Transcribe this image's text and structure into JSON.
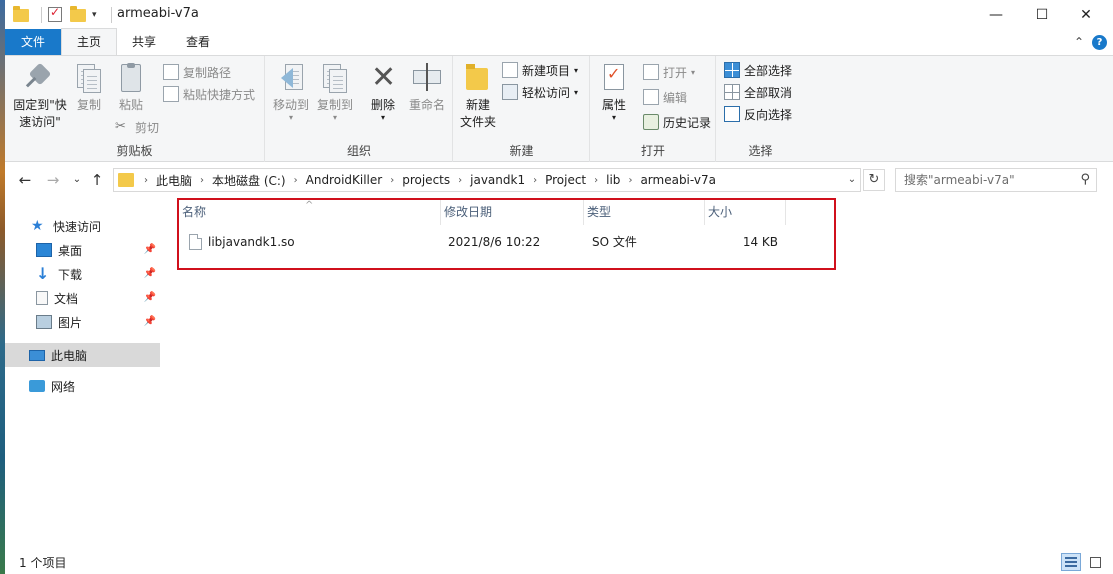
{
  "window": {
    "title": "armeabi-v7a",
    "minimize_glyph": "—",
    "maximize_glyph": "☐",
    "close_glyph": "✕"
  },
  "tabs": [
    {
      "label": "文件"
    },
    {
      "label": "主页"
    },
    {
      "label": "共享"
    },
    {
      "label": "查看"
    }
  ],
  "ribbon": {
    "clipboard": {
      "label": "剪贴板",
      "pin_label_1": "固定到\"快",
      "pin_label_2": "速访问\"",
      "copy_label": "复制",
      "paste_label": "粘贴",
      "copy_path_label": "复制路径",
      "paste_shortcut_label": "粘贴快捷方式",
      "cut_label": "剪切"
    },
    "organize": {
      "label": "组织",
      "move_to_label": "移动到",
      "copy_to_label": "复制到",
      "delete_label": "删除",
      "rename_label": "重命名"
    },
    "new": {
      "label": "新建",
      "new_folder_label_1": "新建",
      "new_folder_label_2": "文件夹",
      "new_item_label": "新建项目",
      "easy_access_label": "轻松访问"
    },
    "open": {
      "label": "打开",
      "properties_label": "属性",
      "open_label": "打开",
      "edit_label": "编辑",
      "history_label": "历史记录"
    },
    "select": {
      "label": "选择",
      "select_all_label": "全部选择",
      "select_none_label": "全部取消",
      "invert_label": "反向选择"
    }
  },
  "address": {
    "crumbs": [
      "此电脑",
      "本地磁盘 (C:)",
      "AndroidKiller",
      "projects",
      "javandk1",
      "Project",
      "lib",
      "armeabi-v7a"
    ],
    "search_placeholder": "搜索\"armeabi-v7a\""
  },
  "nav": {
    "quick_access": "快速访问",
    "desktop": "桌面",
    "downloads": "下载",
    "documents": "文档",
    "pictures": "图片",
    "this_pc": "此电脑",
    "network": "网络"
  },
  "columns": {
    "name": "名称",
    "modified": "修改日期",
    "type": "类型",
    "size": "大小"
  },
  "files": [
    {
      "name": "libjavandk1.so",
      "modified": "2021/8/6 10:22",
      "type": "SO 文件",
      "size": "14 KB"
    }
  ],
  "status": {
    "item_count": "1 个项目"
  },
  "colors": {
    "file_tab": "#1979ca",
    "highlight_box": "#d0101c",
    "selected_nav": "#d9d9d9"
  }
}
